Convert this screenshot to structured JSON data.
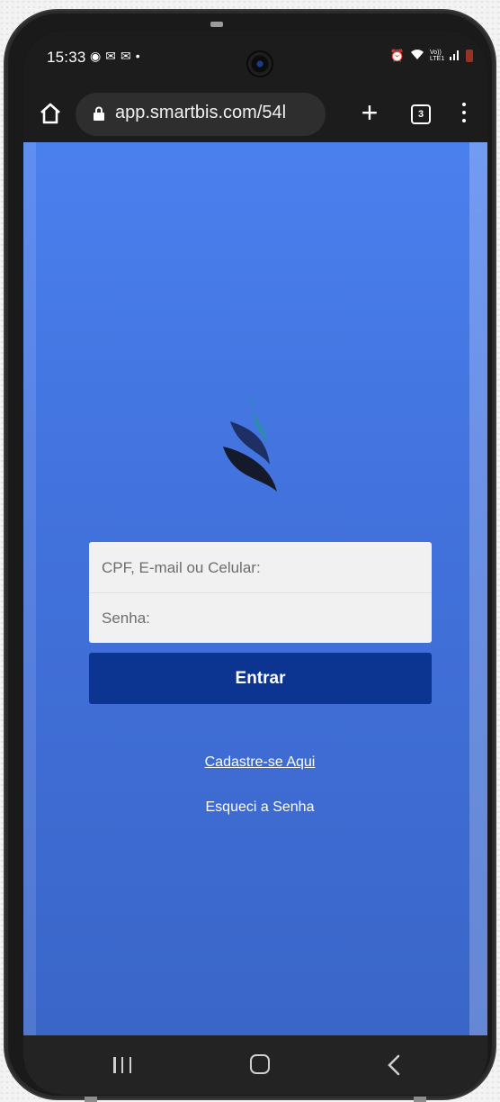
{
  "status_bar": {
    "time": "15:33",
    "left_icons": [
      "chrome-icon",
      "mail-icon",
      "mail-icon",
      "dot-icon"
    ],
    "right_icons": [
      "alarm-icon",
      "wifi-icon",
      "volte-icon",
      "signal-icon",
      "battery-icon"
    ],
    "network_label": "Vo)) LTE1"
  },
  "browser": {
    "url": "app.smartbis.com/54l",
    "tab_count": "3"
  },
  "login": {
    "user_placeholder": "CPF, E-mail ou Celular:",
    "password_placeholder": "Senha:",
    "submit_label": "Entrar",
    "register_link": "Cadastre-se Aqui",
    "forgot_link": "Esqueci a Senha"
  },
  "colors": {
    "background_top": "#4a80ee",
    "background_bottom": "#3a66c8",
    "button": "#0c3592",
    "field_bg": "#f1f1f1"
  }
}
